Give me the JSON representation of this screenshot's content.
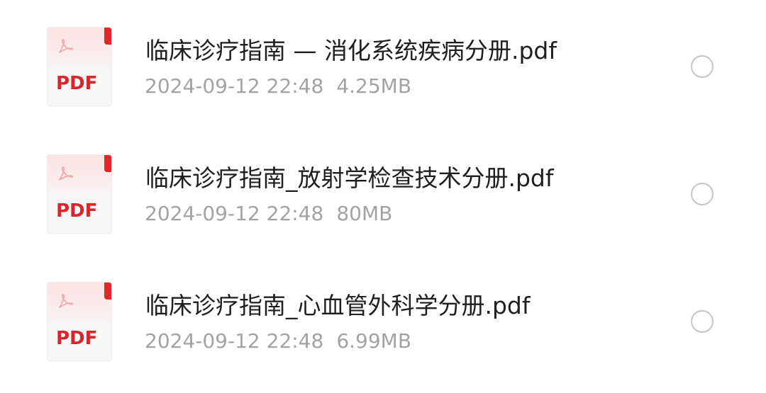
{
  "files": [
    {
      "name": "临床诊疗指南 — 消化系统疾病分册.pdf",
      "date": "2024-09-12 22:48",
      "size": "4.25MB",
      "type_label": "PDF"
    },
    {
      "name": "临床诊疗指南_放射学检查技术分册.pdf",
      "date": "2024-09-12 22:48",
      "size": "80MB",
      "type_label": "PDF"
    },
    {
      "name": "临床诊疗指南_心血管外科学分册.pdf",
      "date": "2024-09-12 22:48",
      "size": "6.99MB",
      "type_label": "PDF"
    }
  ],
  "colors": {
    "pdf_red": "#d9262c",
    "title_text": "#1f1f1f",
    "meta_text": "#a3a3a3",
    "radio_border": "#c6c6c6"
  },
  "icons": {
    "file_type": "pdf-file-icon",
    "acrobat_mark": "acrobat-logo-icon",
    "select": "radio-unchecked-icon"
  }
}
